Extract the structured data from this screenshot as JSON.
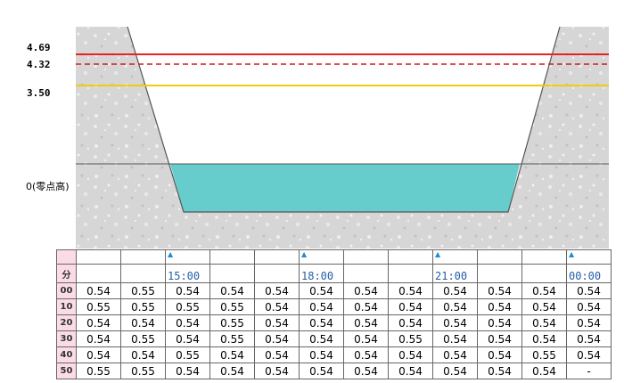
{
  "levels": {
    "red": {
      "label": "4.69",
      "color": "#e8231d",
      "style": "solid"
    },
    "red_dashed": {
      "label": "4.32",
      "color": "#d01818",
      "style": "dashed"
    },
    "yellow": {
      "label": "3.50",
      "color": "#f0cc10",
      "style": "solid"
    },
    "zero": {
      "label": "0(零点高)",
      "color": "#555555"
    }
  },
  "water": {
    "color": "#66cccc"
  },
  "terrain": {
    "color": "#d4d4d4"
  },
  "table": {
    "minute_header": "分",
    "time_marks": [
      {
        "col": 2,
        "label": "15:00"
      },
      {
        "col": 5,
        "label": "18:00"
      },
      {
        "col": 8,
        "label": "21:00"
      },
      {
        "col": 11,
        "label": "00:00"
      }
    ],
    "rows": [
      {
        "minute": "00",
        "values": [
          "0.54",
          "0.55",
          "0.54",
          "0.54",
          "0.54",
          "0.54",
          "0.54",
          "0.54",
          "0.54",
          "0.54",
          "0.54",
          "0.54"
        ]
      },
      {
        "minute": "10",
        "values": [
          "0.55",
          "0.55",
          "0.55",
          "0.55",
          "0.54",
          "0.54",
          "0.54",
          "0.54",
          "0.54",
          "0.54",
          "0.54",
          "0.54"
        ]
      },
      {
        "minute": "20",
        "values": [
          "0.54",
          "0.54",
          "0.54",
          "0.55",
          "0.54",
          "0.54",
          "0.54",
          "0.54",
          "0.54",
          "0.54",
          "0.54",
          "0.54"
        ]
      },
      {
        "minute": "30",
        "values": [
          "0.54",
          "0.55",
          "0.54",
          "0.55",
          "0.54",
          "0.54",
          "0.54",
          "0.55",
          "0.54",
          "0.54",
          "0.54",
          "0.54"
        ]
      },
      {
        "minute": "40",
        "values": [
          "0.54",
          "0.54",
          "0.55",
          "0.54",
          "0.54",
          "0.54",
          "0.54",
          "0.54",
          "0.54",
          "0.54",
          "0.55",
          "0.54"
        ]
      },
      {
        "minute": "50",
        "values": [
          "0.55",
          "0.55",
          "0.54",
          "0.54",
          "0.54",
          "0.54",
          "0.54",
          "0.54",
          "0.54",
          "0.54",
          "0.54",
          "-"
        ]
      }
    ]
  }
}
